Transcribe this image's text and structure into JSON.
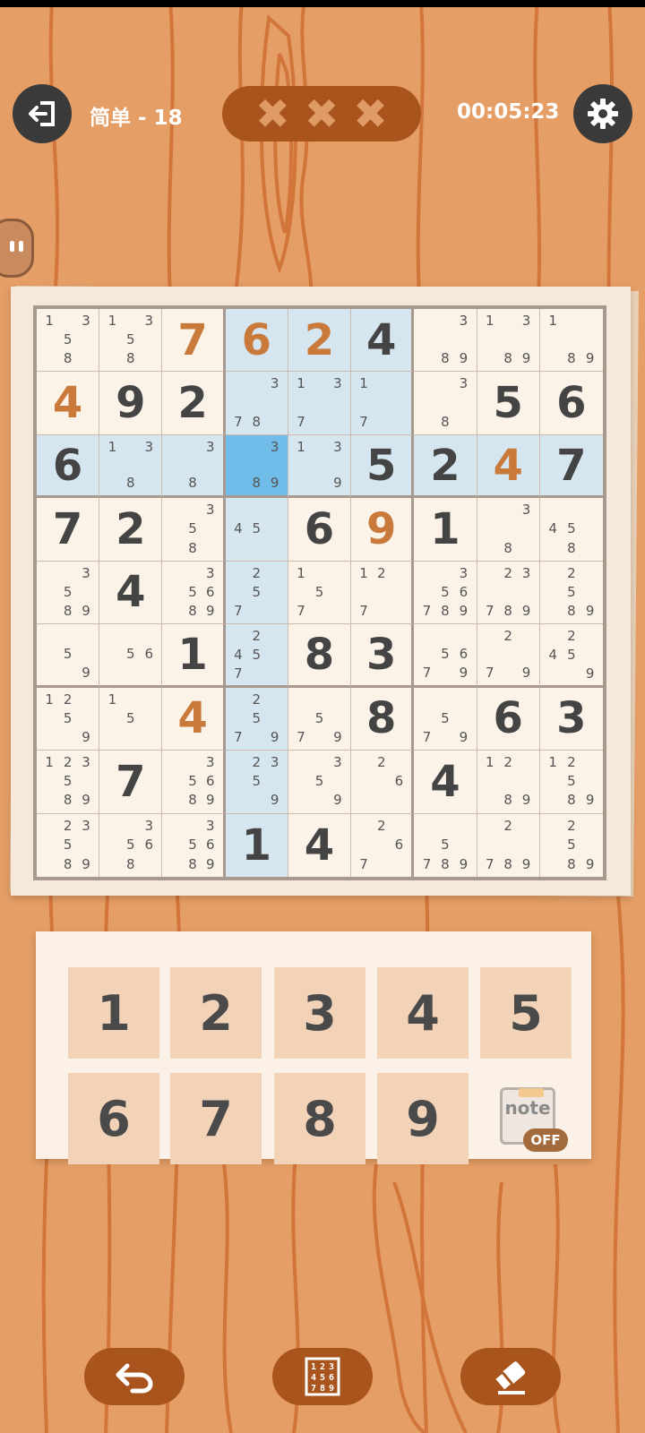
{
  "header": {
    "level": "简单 - 18",
    "mistakes": [
      "✖",
      "✖",
      "✖"
    ],
    "timer": "00:05:23"
  },
  "board": {
    "selected_cell": [
      2,
      3
    ],
    "highlighted_cells": [
      [
        0,
        3
      ],
      [
        0,
        4
      ],
      [
        0,
        5
      ],
      [
        1,
        3
      ],
      [
        1,
        4
      ],
      [
        1,
        5
      ],
      [
        2,
        0
      ],
      [
        2,
        1
      ],
      [
        2,
        2
      ],
      [
        2,
        4
      ],
      [
        2,
        5
      ],
      [
        2,
        6
      ],
      [
        2,
        7
      ],
      [
        2,
        8
      ],
      [
        3,
        3
      ],
      [
        4,
        3
      ],
      [
        5,
        3
      ],
      [
        6,
        3
      ],
      [
        7,
        3
      ],
      [
        8,
        3
      ]
    ],
    "cells": [
      [
        {
          "notes": "1,3,5,8"
        },
        {
          "notes": "1,3,5,8"
        },
        {
          "value": "7",
          "user": true
        },
        {
          "value": "6",
          "user": true
        },
        {
          "value": "2",
          "user": true
        },
        {
          "value": "4"
        },
        {
          "notes": "3,8,9"
        },
        {
          "notes": "1,3,8,9"
        },
        {
          "notes": "1,8,9"
        }
      ],
      [
        {
          "value": "4",
          "user": true
        },
        {
          "value": "9"
        },
        {
          "value": "2"
        },
        {
          "notes": "3,7,8"
        },
        {
          "notes": "1,3,7"
        },
        {
          "notes": "1,7"
        },
        {
          "notes": "3,8"
        },
        {
          "value": "5"
        },
        {
          "value": "6"
        }
      ],
      [
        {
          "value": "6"
        },
        {
          "notes": "1,3,8"
        },
        {
          "notes": "3,8"
        },
        {
          "notes": "3,8,9"
        },
        {
          "notes": "1,3,9"
        },
        {
          "value": "5"
        },
        {
          "value": "2"
        },
        {
          "value": "4",
          "user": true
        },
        {
          "value": "7"
        }
      ],
      [
        {
          "value": "7"
        },
        {
          "value": "2"
        },
        {
          "notes": "3,5,8"
        },
        {
          "notes": "4,5"
        },
        {
          "value": "6"
        },
        {
          "value": "9",
          "user": true
        },
        {
          "value": "1"
        },
        {
          "notes": "3,8"
        },
        {
          "notes": "4,5,8"
        }
      ],
      [
        {
          "notes": "3,5,8,9"
        },
        {
          "value": "4"
        },
        {
          "notes": "3,5,6,8,9"
        },
        {
          "notes": "2,5,7"
        },
        {
          "notes": "1,5,7"
        },
        {
          "notes": "1,2,7"
        },
        {
          "notes": "3,5,6,7,8,9"
        },
        {
          "notes": "2,3,7,8,9"
        },
        {
          "notes": "2,5,8,9"
        }
      ],
      [
        {
          "notes": "5,9"
        },
        {
          "notes": "5,6"
        },
        {
          "value": "1"
        },
        {
          "notes": "2,4,5,7"
        },
        {
          "value": "8"
        },
        {
          "value": "3"
        },
        {
          "notes": "5,6,7,9"
        },
        {
          "notes": "2,7,9"
        },
        {
          "notes": "2,4,5,9"
        }
      ],
      [
        {
          "notes": "1,2,5,9"
        },
        {
          "notes": "1,5"
        },
        {
          "value": "4",
          "user": true
        },
        {
          "notes": "2,5,7,9"
        },
        {
          "notes": "5,7,9"
        },
        {
          "value": "8"
        },
        {
          "notes": "5,7,9"
        },
        {
          "value": "6"
        },
        {
          "value": "3"
        }
      ],
      [
        {
          "notes": "1,2,3,5,8,9"
        },
        {
          "value": "7"
        },
        {
          "notes": "3,5,6,8,9"
        },
        {
          "notes": "2,3,5,9"
        },
        {
          "notes": "3,5,9"
        },
        {
          "notes": "2,6"
        },
        {
          "value": "4"
        },
        {
          "notes": "1,2,8,9"
        },
        {
          "notes": "1,2,5,8,9"
        }
      ],
      [
        {
          "notes": "2,3,5,8,9"
        },
        {
          "notes": "3,5,6,8"
        },
        {
          "notes": "3,5,6,8,9"
        },
        {
          "value": "1"
        },
        {
          "value": "4"
        },
        {
          "notes": "2,6,7"
        },
        {
          "notes": "5,7,8,9"
        },
        {
          "notes": "2,7,8,9"
        },
        {
          "notes": "2,5,8,9"
        }
      ]
    ]
  },
  "keypad": {
    "keys": [
      "1",
      "2",
      "3",
      "4",
      "5",
      "6",
      "7",
      "8",
      "9"
    ],
    "note_label": "note",
    "note_state": "OFF"
  },
  "icons": {
    "exit": "exit-icon",
    "settings": "gear-icon",
    "undo": "undo-icon",
    "fast_notes": "number-grid-icon",
    "eraser": "eraser-icon"
  },
  "colors": {
    "user_digit": "#c97a3a",
    "given_digit": "#444444",
    "highlight": "#d6e6f0",
    "selected": "#6fbde8",
    "button_brown": "#a9541c"
  }
}
